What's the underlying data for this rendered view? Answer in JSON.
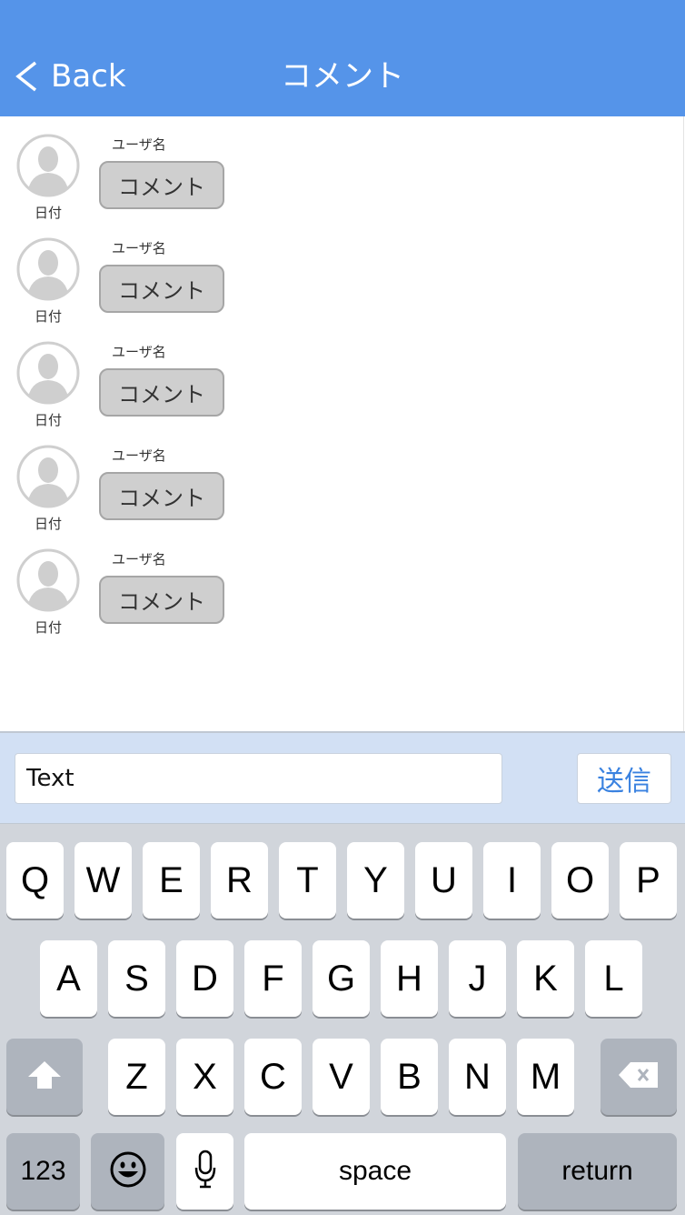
{
  "header": {
    "back_label": "Back",
    "title": "コメント",
    "color": "#5594e9"
  },
  "comments": [
    {
      "username": "ユーザ名",
      "comment": "コメント",
      "date": "日付"
    },
    {
      "username": "ユーザ名",
      "comment": "コメント",
      "date": "日付"
    },
    {
      "username": "ユーザ名",
      "comment": "コメント",
      "date": "日付"
    },
    {
      "username": "ユーザ名",
      "comment": "コメント",
      "date": "日付"
    },
    {
      "username": "ユーザ名",
      "comment": "コメント",
      "date": "日付"
    }
  ],
  "input_bar": {
    "text_value": "Text",
    "send_label": "送信"
  },
  "keyboard": {
    "row1": [
      "Q",
      "W",
      "E",
      "R",
      "T",
      "Y",
      "U",
      "I",
      "O",
      "P"
    ],
    "row2": [
      "A",
      "S",
      "D",
      "F",
      "G",
      "H",
      "J",
      "K",
      "L"
    ],
    "row3": [
      "Z",
      "X",
      "C",
      "V",
      "B",
      "N",
      "M"
    ],
    "numbers_label": "123",
    "space_label": "space",
    "return_label": "return",
    "icons": [
      "shift-icon",
      "backspace-icon",
      "emoji-icon",
      "microphone-icon"
    ]
  }
}
